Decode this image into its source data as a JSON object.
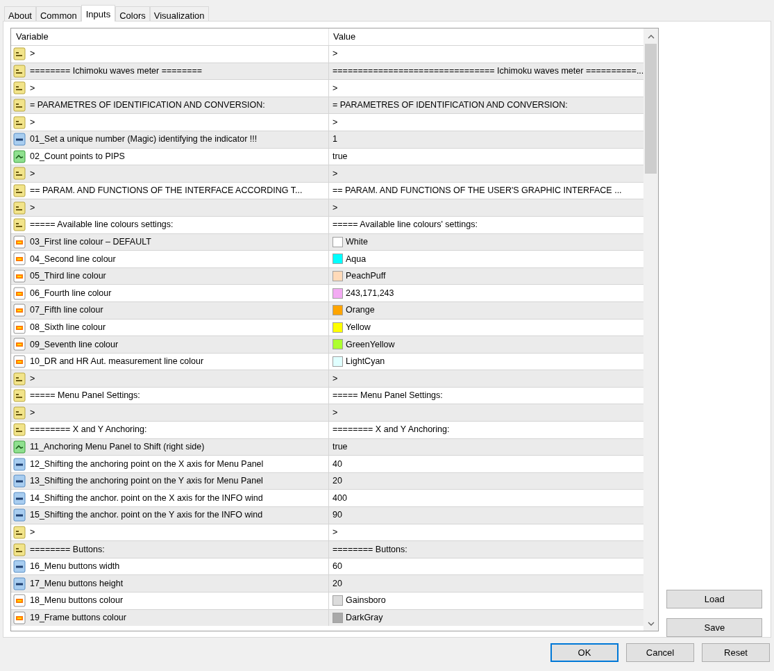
{
  "tabs": [
    {
      "label": "About",
      "selected": false
    },
    {
      "label": "Common",
      "selected": false
    },
    {
      "label": "Inputs",
      "selected": true
    },
    {
      "label": "Colors",
      "selected": false
    },
    {
      "label": "Visualization",
      "selected": false
    }
  ],
  "table": {
    "columns": [
      "Variable",
      "Value"
    ],
    "rows": [
      {
        "kind": "text",
        "variable": ">",
        "value": ">"
      },
      {
        "kind": "text",
        "variable": "======== Ichimoku waves meter ========",
        "value": "================================ Ichimoku waves meter ==========..."
      },
      {
        "kind": "text",
        "variable": ">",
        "value": ">"
      },
      {
        "kind": "text",
        "variable": "= PARAMETRES OF IDENTIFICATION AND CONVERSION:",
        "value": "= PARAMETRES OF IDENTIFICATION AND CONVERSION:"
      },
      {
        "kind": "text",
        "variable": ">",
        "value": ">"
      },
      {
        "kind": "number",
        "variable": "01_Set a unique number (Magic) identifying the indicator !!!",
        "value": "1"
      },
      {
        "kind": "bool",
        "variable": "02_Count points to PIPS",
        "value": "true"
      },
      {
        "kind": "text",
        "variable": ">",
        "value": ">"
      },
      {
        "kind": "text",
        "variable": "== PARAM. AND FUNCTIONS OF THE INTERFACE ACCORDING T...",
        "value": "== PARAM. AND FUNCTIONS OF THE USER'S GRAPHIC INTERFACE ..."
      },
      {
        "kind": "text",
        "variable": ">",
        "value": ">"
      },
      {
        "kind": "text",
        "variable": "===== Available line colours settings:",
        "value": "===== Available line colours' settings:"
      },
      {
        "kind": "color",
        "variable": "03_First line colour – DEFAULT",
        "value": "White",
        "color": "#ffffff"
      },
      {
        "kind": "color",
        "variable": "04_Second line colour",
        "value": "Aqua",
        "color": "#00ffff"
      },
      {
        "kind": "color",
        "variable": "05_Third line colour",
        "value": "PeachPuff",
        "color": "#ffdab9"
      },
      {
        "kind": "color",
        "variable": "06_Fourth line colour",
        "value": "243,171,243",
        "color": "#f3abf3"
      },
      {
        "kind": "color",
        "variable": "07_Fifth line colour",
        "value": "Orange",
        "color": "#ffa500"
      },
      {
        "kind": "color",
        "variable": "08_Sixth line colour",
        "value": "Yellow",
        "color": "#ffff00"
      },
      {
        "kind": "color",
        "variable": "09_Seventh line colour",
        "value": "GreenYellow",
        "color": "#adff2f"
      },
      {
        "kind": "color",
        "variable": "10_DR and HR Aut. measurement line colour",
        "value": "LightCyan",
        "color": "#e0ffff"
      },
      {
        "kind": "text",
        "variable": ">",
        "value": ">"
      },
      {
        "kind": "text",
        "variable": "===== Menu Panel Settings:",
        "value": "===== Menu Panel Settings:"
      },
      {
        "kind": "text",
        "variable": ">",
        "value": ">"
      },
      {
        "kind": "text",
        "variable": "======== X and Y Anchoring:",
        "value": "======== X and Y Anchoring:"
      },
      {
        "kind": "bool",
        "variable": "11_Anchoring Menu Panel to Shift (right side)",
        "value": "true"
      },
      {
        "kind": "number",
        "variable": "12_Shifting the anchoring point on the X axis for Menu Panel",
        "value": "40"
      },
      {
        "kind": "number",
        "variable": "13_Shifting the anchoring point on the Y axis for Menu Panel",
        "value": "20"
      },
      {
        "kind": "number",
        "variable": "14_Shifting the anchor. point on the X axis for the INFO wind",
        "value": "400"
      },
      {
        "kind": "number",
        "variable": "15_Shifting the anchor. point on the Y axis for the INFO wind",
        "value": "90"
      },
      {
        "kind": "text",
        "variable": ">",
        "value": ">"
      },
      {
        "kind": "text",
        "variable": "======== Buttons:",
        "value": "======== Buttons:"
      },
      {
        "kind": "number",
        "variable": "16_Menu buttons width",
        "value": "60"
      },
      {
        "kind": "number",
        "variable": "17_Menu buttons height",
        "value": "20"
      },
      {
        "kind": "color",
        "variable": "18_Menu buttons colour",
        "value": "Gainsboro",
        "color": "#dcdcdc"
      },
      {
        "kind": "color",
        "variable": "19_Frame buttons colour",
        "value": "DarkGray",
        "color": "#a9a9a9"
      }
    ]
  },
  "side_buttons": [
    "Load",
    "Save"
  ],
  "dialog_buttons": [
    {
      "label": "OK",
      "focused": true
    },
    {
      "label": "Cancel",
      "focused": false
    },
    {
      "label": "Reset",
      "focused": false
    }
  ]
}
